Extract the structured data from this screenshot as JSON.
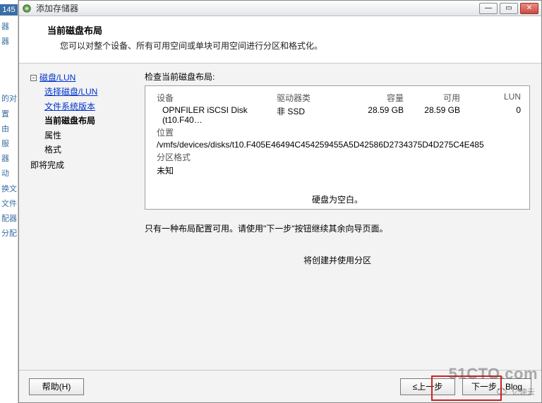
{
  "left_strip": {
    "badge": "145",
    "items": [
      "器",
      "器",
      "的对",
      "置",
      "由",
      "服",
      "器",
      "动",
      "换文",
      "文件",
      "配器",
      "分配"
    ]
  },
  "window": {
    "title": "添加存储器",
    "controls": {
      "min": "—",
      "max": "▭",
      "close": "✕"
    }
  },
  "header": {
    "title": "当前磁盘布局",
    "subtitle": "您可以对整个设备、所有可用空间或单块可用空间进行分区和格式化。"
  },
  "nav": {
    "root": "磁盘/LUN",
    "children": [
      {
        "label": "选择磁盘/LUN",
        "type": "link"
      },
      {
        "label": "文件系统版本",
        "type": "link"
      },
      {
        "label": "当前磁盘布局",
        "type": "current"
      },
      {
        "label": "属性",
        "type": "plain"
      },
      {
        "label": "格式",
        "type": "plain"
      }
    ],
    "ready": "即将完成"
  },
  "content": {
    "section_label": "检查当前磁盘布局:",
    "columns": {
      "device": "设备",
      "drive": "驱动器类",
      "capacity": "容量",
      "available": "可用",
      "lun": "LUN"
    },
    "row": {
      "device": "OPNFILER iSCSI Disk (t10.F40…",
      "drive": "非 SSD",
      "capacity": "28.59 GB",
      "available": "28.59 GB",
      "lun": "0"
    },
    "loc_label": "位置",
    "loc_value": "/vmfs/devices/disks/t10.F405E46494C454259455A5D42586D2734375D4D275C4E485",
    "fmt_label": "分区格式",
    "fmt_value": "未知",
    "blank_note": "硬盘为空白。",
    "mid_note": "只有一种布局配置可用。请使用\"下一步\"按钮继续其余向导页面。",
    "create_note": "将创建并使用分区"
  },
  "footer": {
    "help": "帮助(H)",
    "back": "≤上一步",
    "next": "下一步",
    "blog_suffix": "…Blog"
  },
  "watermark": {
    "main": "51CTO.com",
    "sub": "亿速云"
  }
}
